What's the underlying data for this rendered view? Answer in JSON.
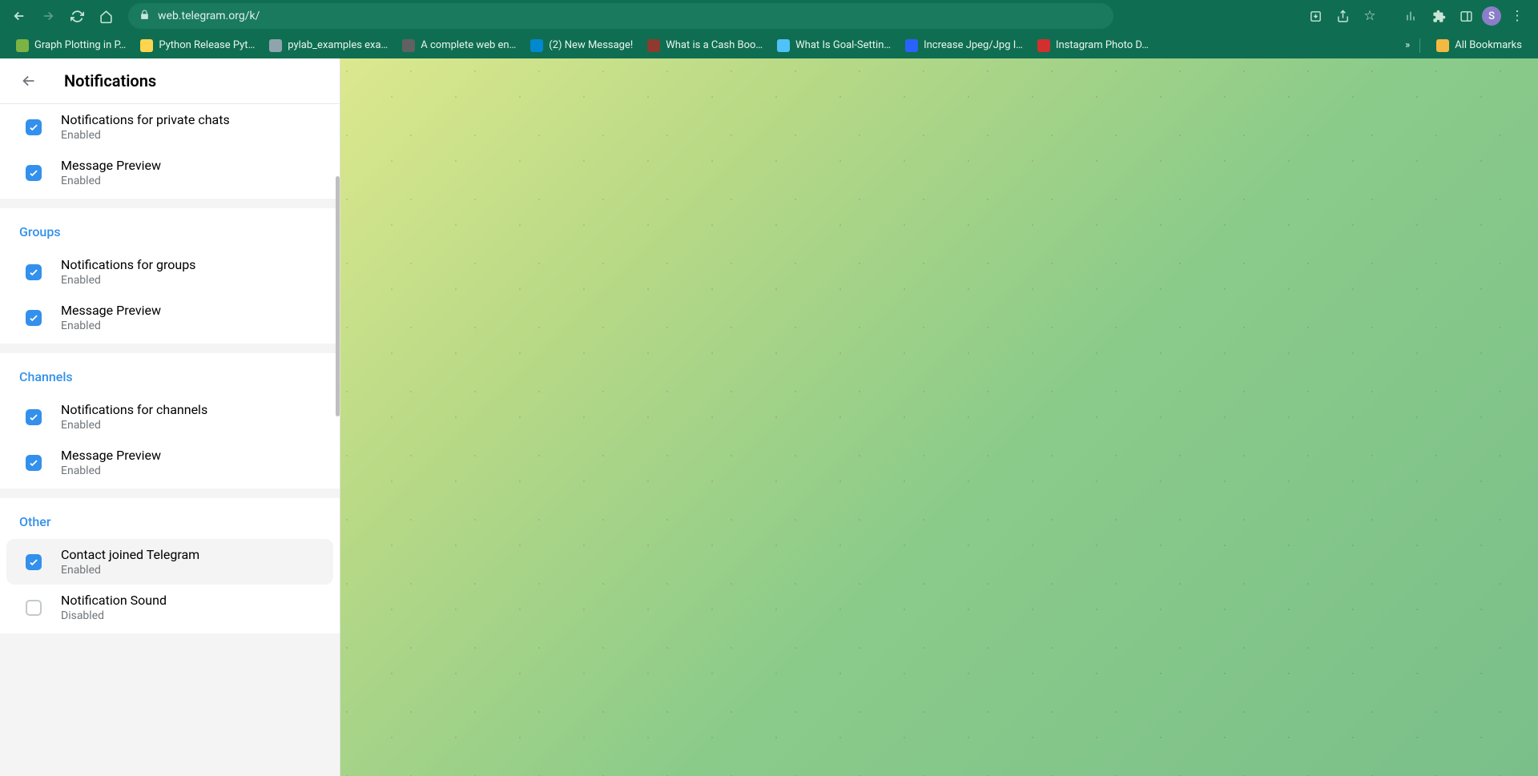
{
  "browser": {
    "url": "web.telegram.org/k/",
    "avatar_letter": "S",
    "bookmarks": [
      {
        "label": "Graph Plotting in P…",
        "color": "#7cb342"
      },
      {
        "label": "Python Release Pyt…",
        "color": "#ffd54f"
      },
      {
        "label": "pylab_examples exa…",
        "color": "#90a4ae"
      },
      {
        "label": "A complete web en…",
        "color": "#616161"
      },
      {
        "label": "(2) New Message!",
        "color": "#0288d1"
      },
      {
        "label": "What is a Cash Boo…",
        "color": "#8d3b2f"
      },
      {
        "label": "What Is Goal-Settin…",
        "color": "#4fc3f7"
      },
      {
        "label": "Increase Jpeg/Jpg I…",
        "color": "#2962ff"
      },
      {
        "label": "Instagram Photo D…",
        "color": "#d32f2f"
      }
    ],
    "overflow": "»",
    "all_bookmarks": "All Bookmarks"
  },
  "sidebar": {
    "title": "Notifications",
    "sections": [
      {
        "header": "",
        "items": [
          {
            "label": "Notifications for private chats",
            "status": "Enabled",
            "checked": true,
            "hovered": false
          },
          {
            "label": "Message Preview",
            "status": "Enabled",
            "checked": true,
            "hovered": false
          }
        ]
      },
      {
        "header": "Groups",
        "items": [
          {
            "label": "Notifications for groups",
            "status": "Enabled",
            "checked": true,
            "hovered": false
          },
          {
            "label": "Message Preview",
            "status": "Enabled",
            "checked": true,
            "hovered": false
          }
        ]
      },
      {
        "header": "Channels",
        "items": [
          {
            "label": "Notifications for channels",
            "status": "Enabled",
            "checked": true,
            "hovered": false
          },
          {
            "label": "Message Preview",
            "status": "Enabled",
            "checked": true,
            "hovered": false
          }
        ]
      },
      {
        "header": "Other",
        "items": [
          {
            "label": "Contact joined Telegram",
            "status": "Enabled",
            "checked": true,
            "hovered": true
          },
          {
            "label": "Notification Sound",
            "status": "Disabled",
            "checked": false,
            "hovered": false
          }
        ]
      }
    ]
  }
}
